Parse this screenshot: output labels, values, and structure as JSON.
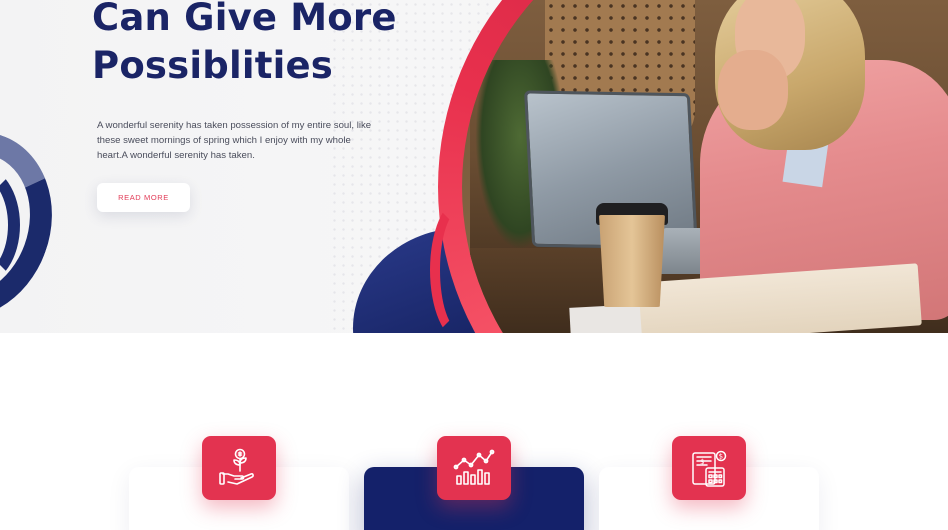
{
  "hero": {
    "title": "Can Give More Possiblities",
    "description": "A wonderful serenity has taken possession of my entire soul, like these sweet mornings of spring which I enjoy with my whole heart.A wonderful serenity has taken.",
    "read_more_label": "READ MORE",
    "colors": {
      "title": "#1a2466",
      "accent_red": "#e33350",
      "navy": "#14216a"
    }
  },
  "features": {
    "cards": [
      {
        "icon": "investment-growth-icon",
        "active": false
      },
      {
        "icon": "analytics-chart-icon",
        "active": true
      },
      {
        "icon": "calculator-finance-icon",
        "active": false
      }
    ]
  }
}
